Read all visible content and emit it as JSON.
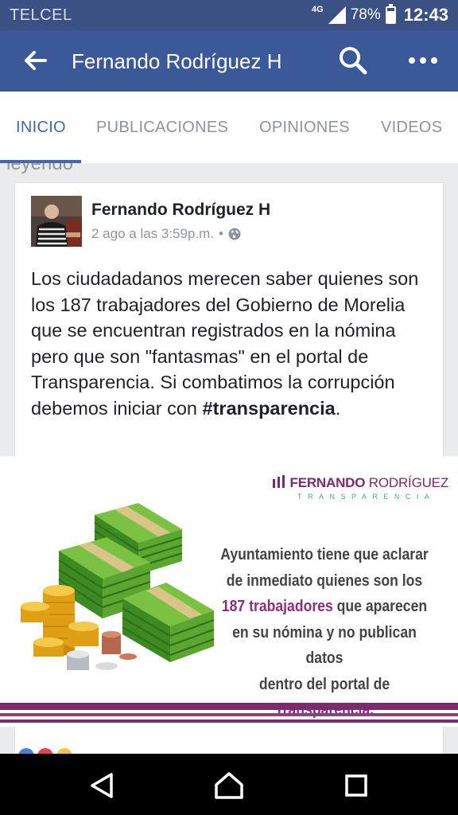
{
  "status_bar": {
    "carrier": "TELCEL",
    "network": "4G",
    "battery_percent": "78%",
    "battery_level": 0.78,
    "time": "12:43"
  },
  "app_bar": {
    "title": "Fernando Rodríguez H",
    "icons": [
      "back-arrow-icon",
      "search-icon",
      "more-dots-icon"
    ]
  },
  "tabs": [
    {
      "label": "INICIO",
      "active": true
    },
    {
      "label": "PUBLICACIONES",
      "active": false
    },
    {
      "label": "OPINIONES",
      "active": false
    },
    {
      "label": "VIDEOS",
      "active": false
    }
  ],
  "previous_post_peek": "leyendo",
  "post": {
    "author": "Fernando Rodríguez H",
    "timestamp": "2 ago a las 3:59p.m.",
    "separator": "•",
    "privacy_icon": "globe-icon",
    "text": "Los ciudadadanos merecen saber quienes son los 187 trabajadores del Gobierno de Morelia que se encuentran registrados en la nómina pero que son \"fantasmas\" en el portal de Transparencia. Si combatimos la corrupción debemos iniciar con ",
    "hashtag": "#transparencia",
    "text_end": "."
  },
  "banner": {
    "brand_first": "FERNANDO",
    "brand_last": "RODRÍGUEZ",
    "brand_sub": "TRANSPARENCIA",
    "line1": "Ayuntamiento tiene que aclarar",
    "line2": "de inmediato quienes son los",
    "line3_accent": "187 trabajadores",
    "line3_rest": " que aparecen",
    "line4": "en su nómina y no publican datos",
    "line5_rest": "dentro del portal de ",
    "line5_accent": "Transparencia",
    "line5_end": ".",
    "colors": {
      "purple": "#7b2a6e",
      "teal": "#4aa3a0",
      "money_green": "#5aa631",
      "coin_gold": "#f2b51c"
    }
  },
  "nav_bar": {
    "icons": [
      "back-triangle-icon",
      "home-icon",
      "recents-square-icon"
    ]
  },
  "colors": {
    "facebook_blue": "#3b5998",
    "status_blue": "#3b5083",
    "tab_active": "#4267b2",
    "tab_inactive": "#8d949e"
  }
}
